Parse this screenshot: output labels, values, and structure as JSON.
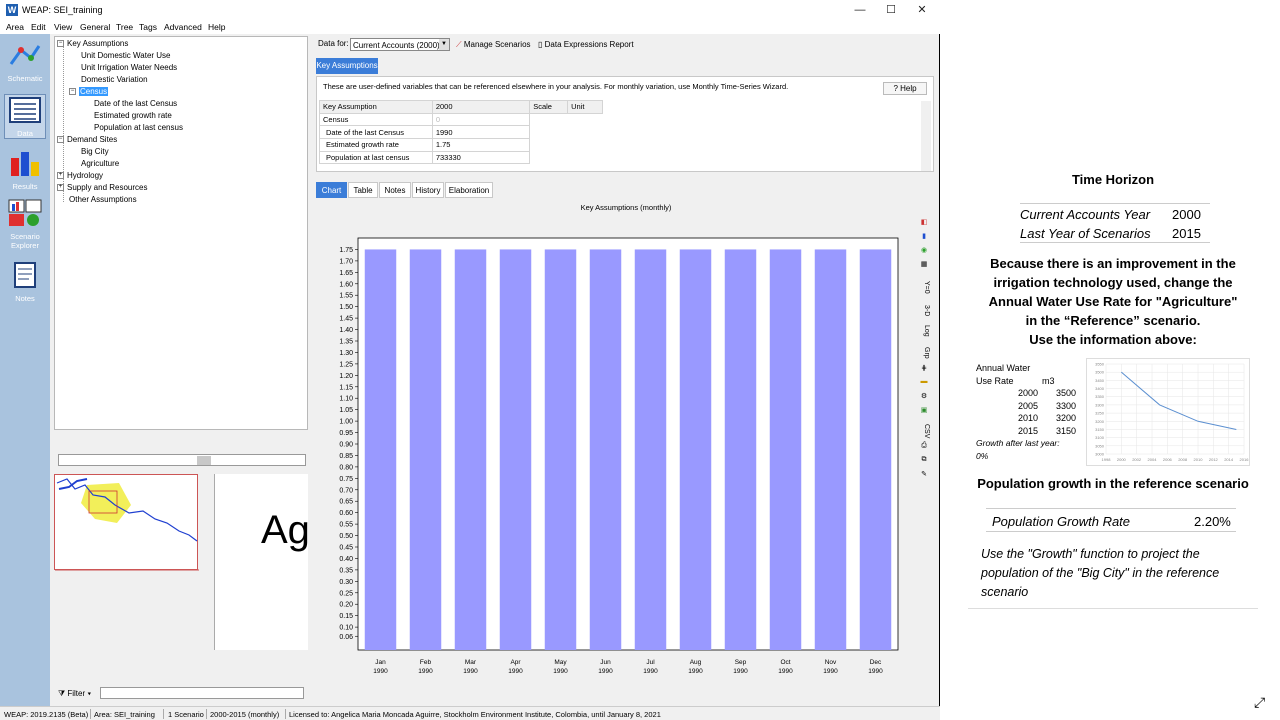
{
  "window": {
    "title": "WEAP: SEI_training",
    "min": "—",
    "max": "☐",
    "close": "✕"
  },
  "menu": [
    "Area",
    "Edit",
    "View",
    "General",
    "Tree",
    "Tags",
    "Advanced",
    "Help"
  ],
  "views": [
    {
      "label": "Schematic"
    },
    {
      "label": "Data"
    },
    {
      "label": "Results"
    },
    {
      "label": "Scenario Explorer"
    },
    {
      "label": "Notes"
    }
  ],
  "tree": {
    "key_assumptions": "Key Assumptions",
    "unit_domestic": "Unit Domestic Water Use",
    "unit_irrigation": "Unit Irrigation Water Needs",
    "domestic_variation": "Domestic Variation",
    "census": "Census",
    "date_last_census": "Date of the last Census",
    "growth_rate": "Estimated growth rate",
    "population": "Population at last census",
    "demand_sites": "Demand Sites",
    "big_city": "Big City",
    "agriculture": "Agriculture",
    "hydrology": "Hydrology",
    "supply": "Supply and Resources",
    "other": "Other Assumptions"
  },
  "preview_text": "Ag",
  "filter_label": "Filter",
  "toolbar": {
    "data_for": "Data for:",
    "data_for_value": "Current Accounts (2000)",
    "manage": "Manage Scenarios",
    "expressions": "Data Expressions Report"
  },
  "ka_tab": "Key Assumptions",
  "ka_desc": "These are user-defined variables that can be referenced elsewhere in your analysis.  For monthly variation, use Monthly Time-Series Wizard.",
  "help": "Help",
  "ka_table": {
    "headers": [
      "Key Assumption",
      "2000",
      "Scale",
      "Unit"
    ],
    "rows": [
      [
        "Census",
        "0"
      ],
      [
        "Date of the last Census",
        "1990"
      ],
      [
        "Estimated growth rate",
        "1.75"
      ],
      [
        "Population at last census",
        "733330"
      ]
    ]
  },
  "chart_tabs": [
    "Chart",
    "Table",
    "Notes",
    "History",
    "Elaboration"
  ],
  "chart_data": {
    "type": "bar",
    "title": "Key Assumptions (monthly)",
    "categories": [
      "Jan 1990",
      "Feb 1990",
      "Mar 1990",
      "Apr 1990",
      "May 1990",
      "Jun 1990",
      "Jul 1990",
      "Aug 1990",
      "Sep 1990",
      "Oct 1990",
      "Nov 1990",
      "Dec 1990"
    ],
    "category_lines": [
      [
        "Jan",
        "1990"
      ],
      [
        "Feb",
        "1990"
      ],
      [
        "Mar",
        "1990"
      ],
      [
        "Apr",
        "1990"
      ],
      [
        "May",
        "1990"
      ],
      [
        "Jun",
        "1990"
      ],
      [
        "Jul",
        "1990"
      ],
      [
        "Aug",
        "1990"
      ],
      [
        "Sep",
        "1990"
      ],
      [
        "Oct",
        "1990"
      ],
      [
        "Nov",
        "1990"
      ],
      [
        "Dec",
        "1990"
      ]
    ],
    "values": [
      1.75,
      1.75,
      1.75,
      1.75,
      1.75,
      1.75,
      1.75,
      1.75,
      1.75,
      1.75,
      1.75,
      1.75
    ],
    "yticks": [
      "0.06",
      "0.10",
      "0.15",
      "0.20",
      "0.25",
      "0.30",
      "0.35",
      "0.40",
      "0.45",
      "0.50",
      "0.55",
      "0.60",
      "0.65",
      "0.70",
      "0.75",
      "0.80",
      "0.85",
      "0.90",
      "0.95",
      "1.00",
      "1.05",
      "1.10",
      "1.15",
      "1.20",
      "1.25",
      "1.30",
      "1.35",
      "1.40",
      "1.45",
      "1.50",
      "1.55",
      "1.60",
      "1.65",
      "1.70",
      "1.75"
    ],
    "ylim": [
      0.0,
      1.8
    ],
    "bar_color": "#9999ff"
  },
  "right_tools": [
    "Y=0",
    "3-D",
    "Log",
    "Grp",
    "CSV"
  ],
  "status": [
    "WEAP: 2019.2135 (Beta)",
    "Area: SEI_training",
    "1 Scenario",
    "2000-2015 (monthly)",
    "Licensed to: Angelica Maria Moncada Aguirre, Stockholm Environment Institute, Colombia, until January 8, 2021"
  ],
  "notes": {
    "time_horizon": "Time Horizon",
    "cay_label": "Current Accounts Year",
    "cay_value": "2000",
    "lys_label": "Last Year of Scenarios",
    "lys_value": "2015",
    "improvement": [
      "Because there is an improvement in the",
      "irrigation technology used, change the",
      "Annual Water Use Rate for \"Agriculture\"",
      "in the “Reference” scenario.",
      "Use the information above:"
    ],
    "awur_title1": "Annual Water",
    "awur_title2": "Use Rate",
    "awur_unit": "m3",
    "awur_rows": [
      [
        "2000",
        "3500"
      ],
      [
        "2005",
        "3300"
      ],
      [
        "2010",
        "3200"
      ],
      [
        "2015",
        "3150"
      ]
    ],
    "growth_after": "Growth after last year:",
    "growth_after_value": "0%",
    "mini_chart": {
      "type": "line",
      "x": [
        2000,
        2005,
        2010,
        2015
      ],
      "values": [
        3500,
        3300,
        3200,
        3150
      ],
      "yticks": [
        "3550",
        "3500",
        "3450",
        "3400",
        "3350",
        "3300",
        "3250",
        "3200",
        "3150",
        "3100",
        "3050",
        "3000"
      ],
      "xticks": [
        "1998",
        "2000",
        "2002",
        "2004",
        "2006",
        "2008",
        "2010",
        "2012",
        "2014",
        "2016"
      ]
    },
    "pop_heading": "Population growth in the reference scenario",
    "pgr_label": "Population Growth Rate",
    "pgr_value": "2.20%",
    "use_growth": [
      "Use the \"Growth\" function to project the",
      "population of the \"Big City\" in the reference",
      "scenario"
    ]
  }
}
